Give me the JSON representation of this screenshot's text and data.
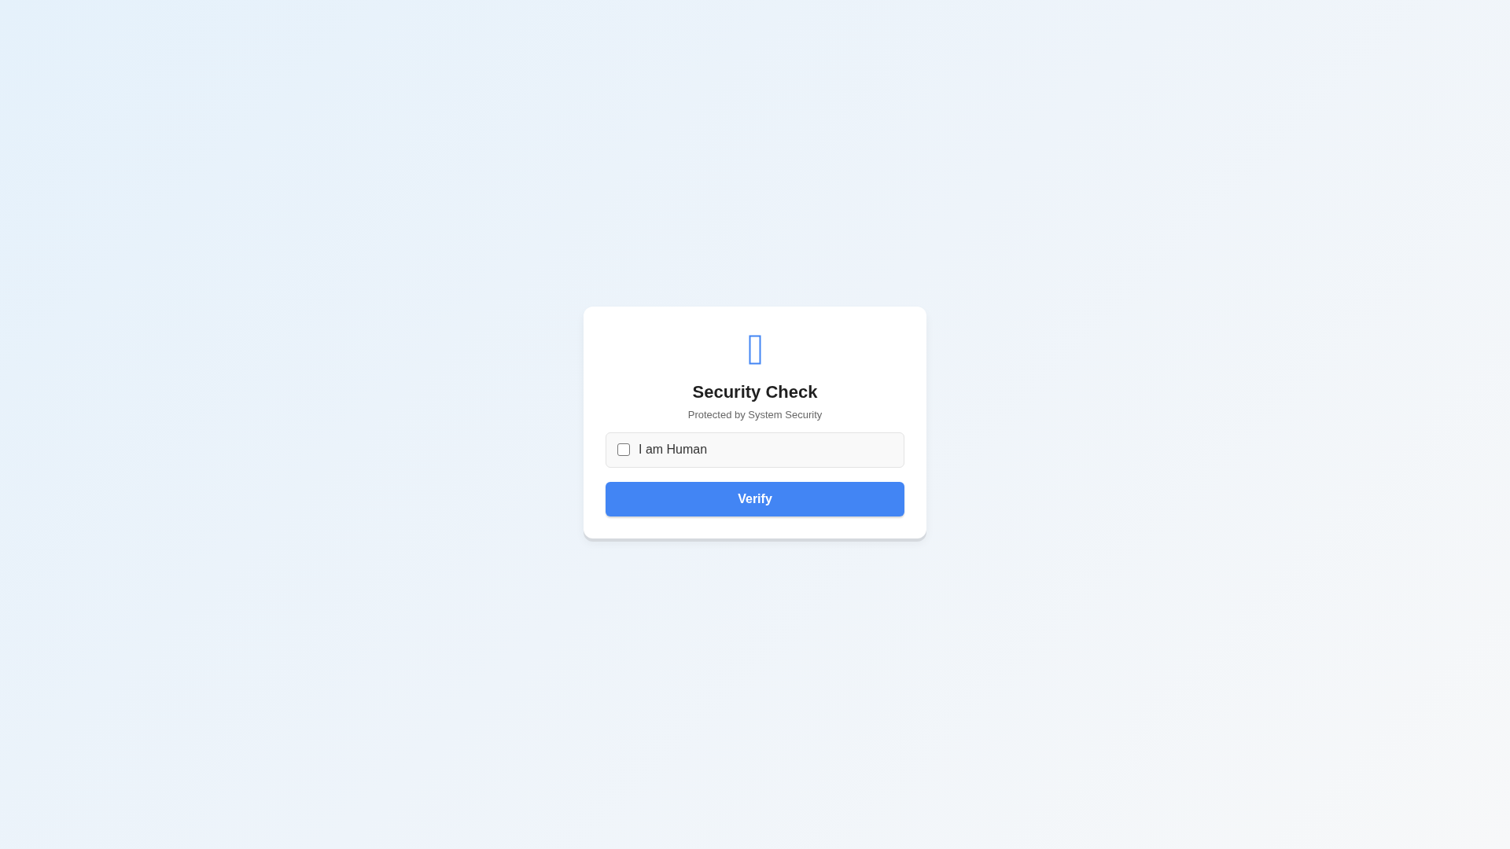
{
  "card": {
    "title": "Security Check",
    "subtitle": "Protected by System Security",
    "checkbox": {
      "label": "I am Human",
      "checked": false
    },
    "button": {
      "label": "Verify"
    }
  }
}
